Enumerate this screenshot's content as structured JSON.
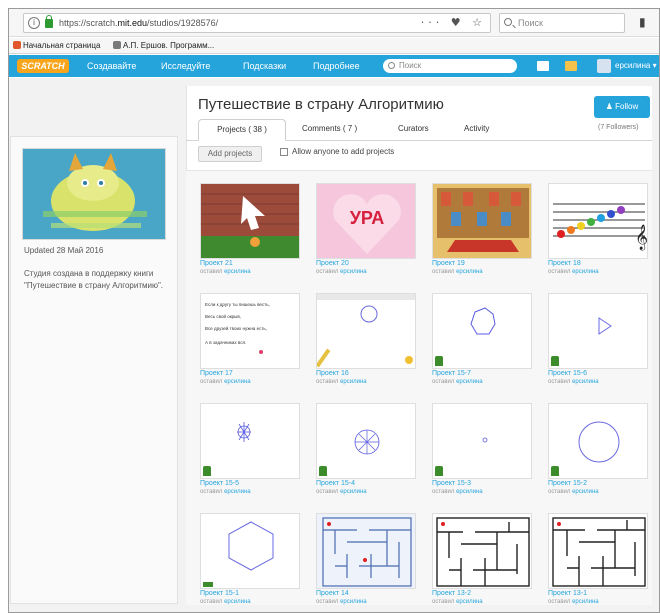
{
  "browser": {
    "url_prefix": "https://scratch.",
    "url_domain": "mit.edu",
    "url_path": "/studios/1928576/",
    "url_icons": "··· ♥ ☆",
    "search_placeholder": "Поиск",
    "menu_icon": "▮"
  },
  "bookmarks": [
    {
      "label": "Начальная страница"
    },
    {
      "label": "А.П. Ершов. Программ..."
    }
  ],
  "navbar": {
    "logo": "SCRATCH",
    "links": [
      "Создавайте",
      "Исследуйте",
      "Подсказки",
      "Подробнее"
    ],
    "search_placeholder": "Поиск",
    "username": "ерсилина ▾"
  },
  "studio": {
    "title": "Путешествие в страну Алгоритмию",
    "follow_label": "Follow",
    "followers": "(7 Followers)",
    "updated": "Updated 28 Май 2016",
    "description": "Студия создана в поддержку книги \"Путешествие в страну Алгоритмию\".",
    "tabs": [
      {
        "label": "Projects ( 38 )"
      },
      {
        "label": "Comments ( 7 )"
      },
      {
        "label": "Curators"
      },
      {
        "label": "Activity"
      }
    ],
    "add_projects": "Add projects",
    "allow_anyone": "Allow anyone to add projects"
  },
  "projects": [
    {
      "name": "Проект 21",
      "by": "оставил",
      "author": "ерсилина"
    },
    {
      "name": "Проект 20",
      "by": "оставил",
      "author": "ерсилина"
    },
    {
      "name": "Проект 19",
      "by": "оставил",
      "author": "ерсилина"
    },
    {
      "name": "Проект 18",
      "by": "оставил",
      "author": "ерсилина"
    },
    {
      "name": "Проект 17",
      "by": "оставил",
      "author": "ерсилина"
    },
    {
      "name": "Проект 16",
      "by": "оставил",
      "author": "ерсилина"
    },
    {
      "name": "Проект 15-7",
      "by": "оставил",
      "author": "ерсилина"
    },
    {
      "name": "Проект 15-6",
      "by": "оставил",
      "author": "ерсилина"
    },
    {
      "name": "Проект 15-5",
      "by": "оставил",
      "author": "ерсилина"
    },
    {
      "name": "Проект 15-4",
      "by": "оставил",
      "author": "ерсилина"
    },
    {
      "name": "Проект 15-3",
      "by": "оставил",
      "author": "ерсилина"
    },
    {
      "name": "Проект 15-2",
      "by": "оставил",
      "author": "ерсилина"
    },
    {
      "name": "Проект 15-1",
      "by": "оставил",
      "author": "ерсилина"
    },
    {
      "name": "Проект 14",
      "by": "оставил",
      "author": "ерсилина"
    },
    {
      "name": "Проект 13-2",
      "by": "оставил",
      "author": "ерсилина"
    },
    {
      "name": "Проект 13-1",
      "by": "оставил",
      "author": "ерсилина"
    }
  ],
  "thumb_text": {
    "ura": "УРА",
    "poem": [
      "Если к другу ты пишешь весть,",
      "Весь свой окрыв,",
      "Все друзей твоих нужна есть,",
      "А в задачниках вся."
    ]
  },
  "colors": {
    "scratch_blue": "#25a4dc",
    "scratch_orange": "#f7a51c",
    "link_blue": "#25a4dc"
  }
}
